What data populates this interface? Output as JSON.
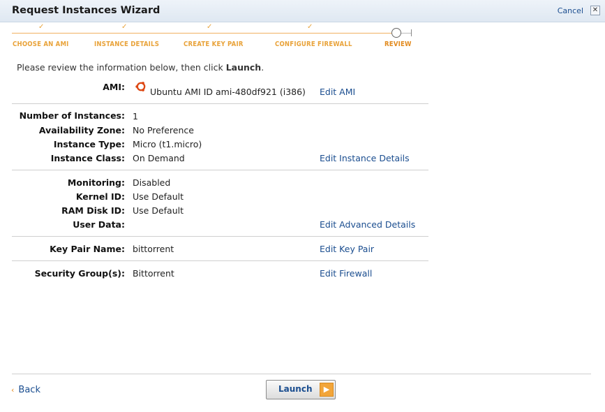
{
  "window": {
    "title": "Request Instances Wizard",
    "cancel_label": "Cancel",
    "close_symbol": "✕"
  },
  "progress": {
    "steps": [
      {
        "label": "CHOOSE AN AMI",
        "state": "complete"
      },
      {
        "label": "INSTANCE DETAILS",
        "state": "complete"
      },
      {
        "label": "CREATE KEY PAIR",
        "state": "complete"
      },
      {
        "label": "CONFIGURE FIREWALL",
        "state": "complete"
      },
      {
        "label": "REVIEW",
        "state": "current"
      }
    ],
    "check_symbol": "✓",
    "accent_color": "#e9a33a"
  },
  "intro": {
    "text_before": "Please review the information below, then click ",
    "bold": "Launch",
    "text_after": "."
  },
  "ami": {
    "label": "AMI:",
    "icon": "ubuntu-logo-icon",
    "value": "Ubuntu AMI ID ami-480df921 (i386)",
    "edit_label": "Edit AMI"
  },
  "instance": {
    "number_label": "Number of Instances:",
    "number_value": "1",
    "zone_label": "Availability Zone:",
    "zone_value": "No Preference",
    "type_label": "Instance Type:",
    "type_value": "Micro (t1.micro)",
    "class_label": "Instance Class:",
    "class_value": "On Demand",
    "edit_label": "Edit Instance Details"
  },
  "advanced": {
    "monitoring_label": "Monitoring:",
    "monitoring_value": "Disabled",
    "kernel_label": "Kernel ID:",
    "kernel_value": "Use Default",
    "ramdisk_label": "RAM Disk ID:",
    "ramdisk_value": "Use Default",
    "userdata_label": "User Data:",
    "userdata_value": "",
    "edit_label": "Edit Advanced Details"
  },
  "keypair": {
    "label": "Key Pair Name:",
    "value": "bittorrent",
    "edit_label": "Edit Key Pair"
  },
  "security": {
    "label": "Security Group(s):",
    "value": "Bittorrent",
    "edit_label": "Edit Firewall"
  },
  "footer": {
    "back_label": "Back",
    "back_icon": "chevron-left-icon",
    "launch_label": "Launch",
    "launch_icon": "arrow-right-icon"
  }
}
